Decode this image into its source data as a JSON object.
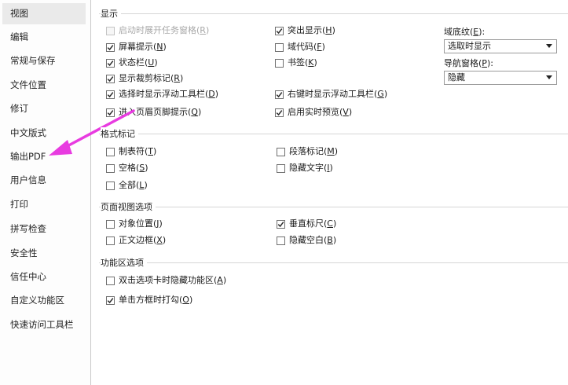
{
  "sidebar": {
    "items": [
      {
        "label": "视图",
        "active": true
      },
      {
        "label": "编辑"
      },
      {
        "label": "常规与保存"
      },
      {
        "label": "文件位置"
      },
      {
        "label": "修订"
      },
      {
        "label": "中文版式"
      },
      {
        "label": "输出PDF"
      },
      {
        "label": "用户信息"
      },
      {
        "label": "打印"
      },
      {
        "label": "拼写检查"
      },
      {
        "label": "安全性"
      },
      {
        "label": "信任中心"
      },
      {
        "label": "自定义功能区"
      },
      {
        "label": "快速访问工具栏"
      }
    ]
  },
  "groups": {
    "display": {
      "title": "显示",
      "options": [
        {
          "text": "启动时展开任务窗格",
          "key": "R",
          "checked": false,
          "disabled": true
        },
        {
          "text": "屏幕提示",
          "key": "N",
          "checked": true
        },
        {
          "text": "状态栏",
          "key": "U",
          "checked": true
        },
        {
          "text": "显示裁剪标记",
          "key": "R",
          "checked": true
        },
        {
          "text": "选择时显示浮动工具栏",
          "key": "D",
          "checked": true
        },
        {
          "text": "进入页眉页脚提示",
          "key": "Q",
          "checked": true
        },
        {
          "text": "突出显示",
          "key": "H",
          "checked": true
        },
        {
          "text": "域代码",
          "key": "F",
          "checked": false
        },
        {
          "text": "书签",
          "key": "K",
          "checked": false
        },
        {
          "text": "右键时显示浮动工具栏",
          "key": "G",
          "checked": true
        },
        {
          "text": "启用实时预览",
          "key": "V",
          "checked": true
        }
      ],
      "field_shading": {
        "label": "域底纹",
        "key": "E",
        "value": "选取时显示"
      },
      "nav_pane": {
        "label": "导航窗格",
        "key": "P",
        "value": "隐藏"
      }
    },
    "format_marks": {
      "title": "格式标记",
      "options": [
        {
          "text": "制表符",
          "key": "T",
          "checked": false
        },
        {
          "text": "空格",
          "key": "S",
          "checked": false
        },
        {
          "text": "全部",
          "key": "L",
          "checked": false
        },
        {
          "text": "段落标记",
          "key": "M",
          "checked": false
        },
        {
          "text": "隐藏文字",
          "key": "I",
          "checked": false
        }
      ]
    },
    "page_view": {
      "title": "页面视图选项",
      "options": [
        {
          "text": "对象位置",
          "key": "J",
          "checked": false
        },
        {
          "text": "正文边框",
          "key": "X",
          "checked": false
        },
        {
          "text": "垂直标尺",
          "key": "C",
          "checked": true
        },
        {
          "text": "隐藏空白",
          "key": "B",
          "checked": false
        }
      ]
    },
    "ribbon": {
      "title": "功能区选项",
      "options": [
        {
          "text": "双击选项卡时隐藏功能区",
          "key": "A",
          "checked": false
        },
        {
          "text": "单击方框时打勾",
          "key": "O",
          "checked": true
        }
      ]
    }
  },
  "colors": {
    "annotation_arrow": "#e83be0"
  }
}
